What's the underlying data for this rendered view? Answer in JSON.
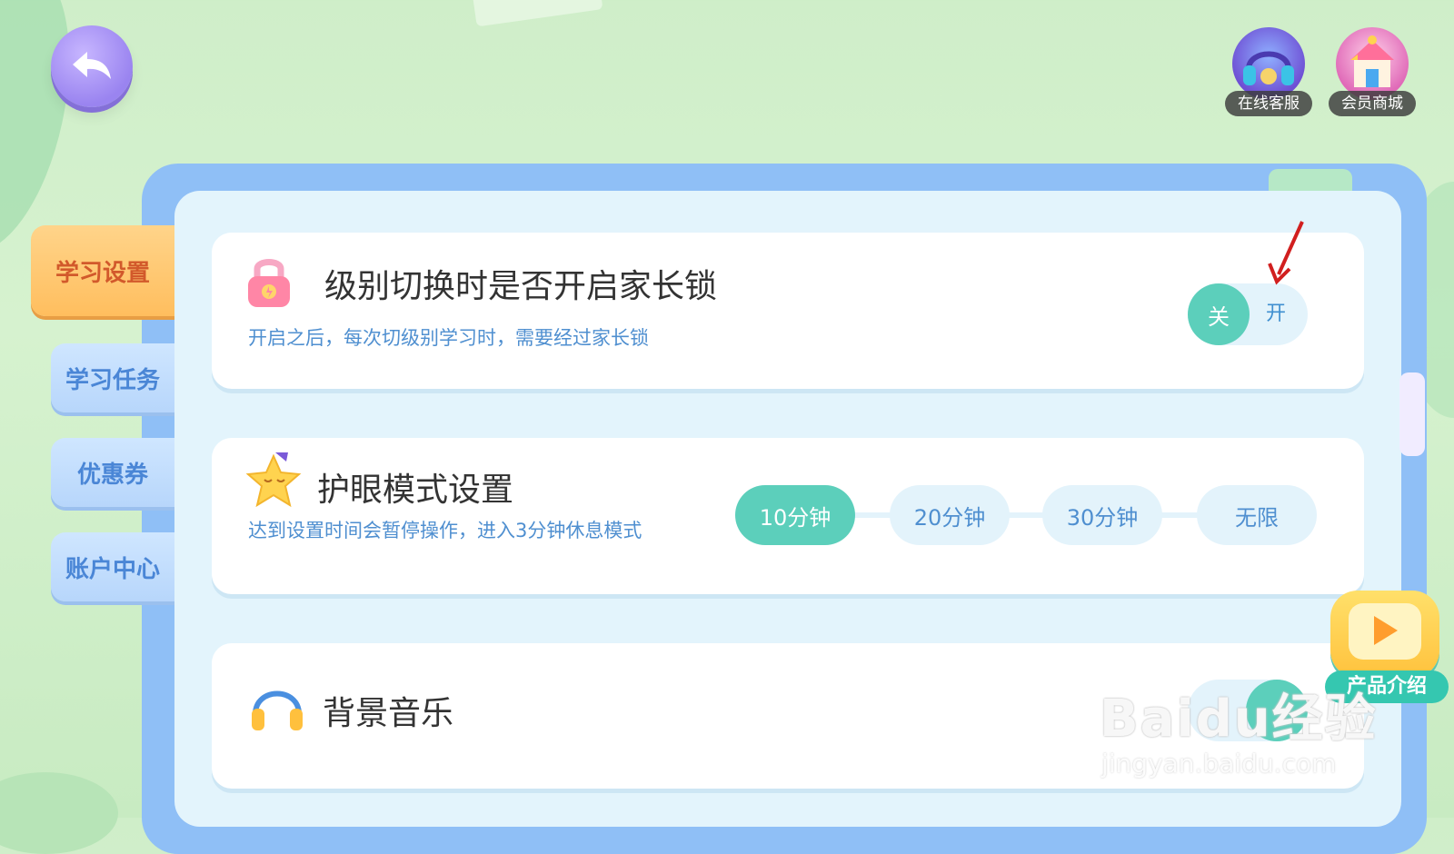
{
  "header": {
    "back_icon": "back-arrow-icon",
    "customer_service_label": "在线客服",
    "member_mall_label": "会员商城"
  },
  "sidebar": {
    "tabs": [
      {
        "label": "学习设置",
        "active": true
      },
      {
        "label": "学习任务",
        "active": false
      },
      {
        "label": "优惠券",
        "active": false
      },
      {
        "label": "账户中心",
        "active": false
      }
    ]
  },
  "settings": {
    "parent_lock": {
      "title": "级别切换时是否开启家长锁",
      "description": "开启之后，每次切级别学习时，需要经过家长锁",
      "toggle_on_label": "关",
      "toggle_off_label": "开",
      "icon": "lock-icon"
    },
    "eye_protection": {
      "title": "护眼模式设置",
      "description": "达到设置时间会暂停操作，进入3分钟休息模式",
      "options": [
        "10分钟",
        "20分钟",
        "30分钟",
        "无限"
      ],
      "selected": "10分钟",
      "icon": "sleepy-star-icon"
    },
    "background_music": {
      "title": "背景音乐",
      "icon": "headphones-icon"
    }
  },
  "floating": {
    "product_intro_label": "产品介绍"
  },
  "watermark": {
    "brand": "Baidu经验",
    "url": "jingyan.baidu.com"
  },
  "colors": {
    "accent_green": "#5ccfbb",
    "tab_active": "#ffbe5e",
    "tab_inactive": "#b7d6fb",
    "text_blue": "#4f8fd0",
    "frame_blue": "#8fbff6"
  }
}
